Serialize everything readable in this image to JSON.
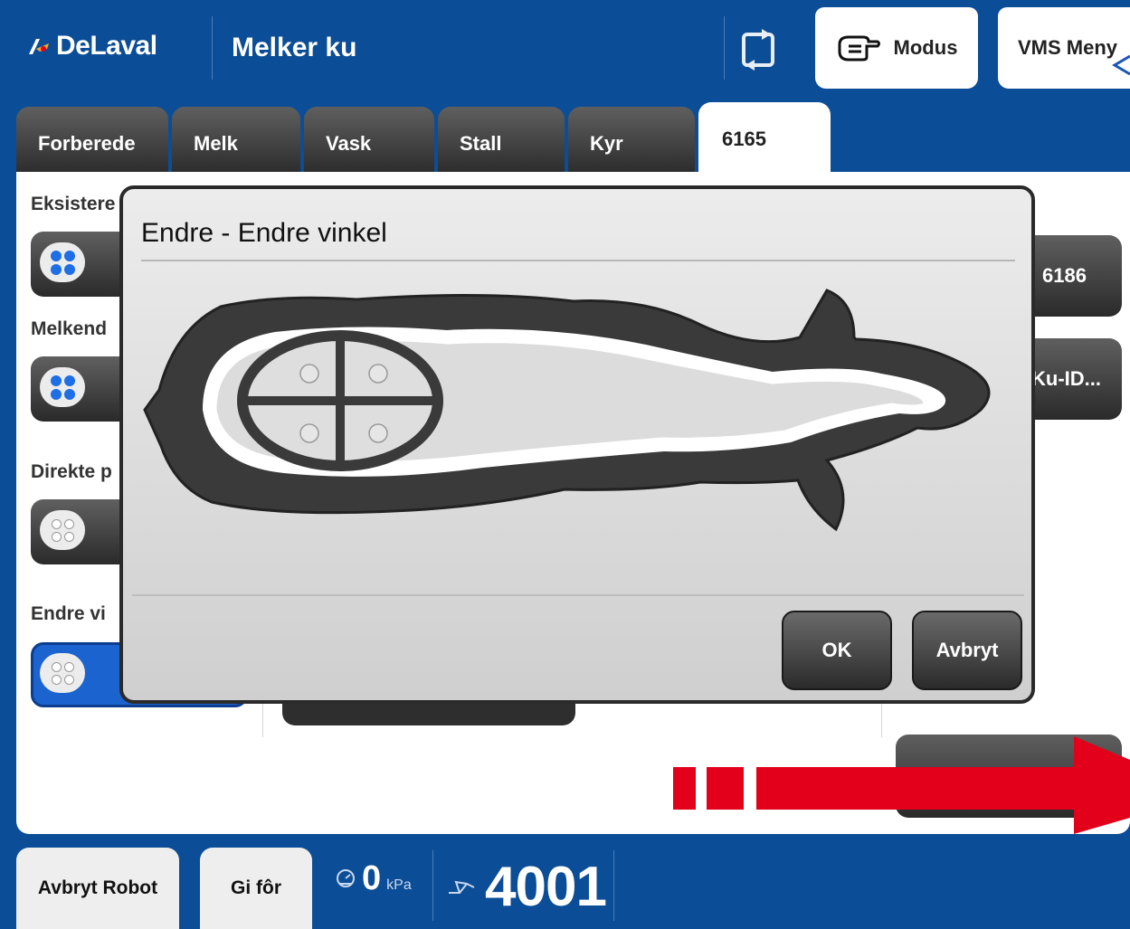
{
  "header": {
    "brand": "DeLaval",
    "title": "Melker ku",
    "modus_label": "Modus",
    "vms_menu_label": "VMS Meny"
  },
  "tabs": [
    {
      "label": "Forberede"
    },
    {
      "label": "Melk"
    },
    {
      "label": "Vask"
    },
    {
      "label": "Stall"
    },
    {
      "label": "Kyr"
    },
    {
      "label": "6165",
      "active": true
    }
  ],
  "main": {
    "sections": [
      {
        "label": "Eksistere",
        "teat_style": "blue"
      },
      {
        "label": "Melkend",
        "teat_style": "blue"
      },
      {
        "label": "Direkte p",
        "teat_style": "grey"
      },
      {
        "label": "Endre vi",
        "teat_style": "grey",
        "selected": true
      }
    ],
    "right_buttons": [
      {
        "label": "6186"
      },
      {
        "label": "Ku-ID..."
      },
      {
        "label": ""
      }
    ]
  },
  "dialog": {
    "title": "Endre - Endre vinkel",
    "ok_label": "OK",
    "cancel_label": "Avbryt"
  },
  "footer": {
    "abort_robot_label": "Avbryt Robot",
    "feed_label": "Gi fôr",
    "vacuum_value": "0",
    "vacuum_unit": "kPa",
    "robot_id": "4001"
  },
  "colors": {
    "header_blue": "#0b4d96",
    "selected_blue": "#1b64d0",
    "teat_blue": "#1e6ee6",
    "arrow_red": "#e2001a",
    "button_dark": "#2b2b2b"
  },
  "icons": {
    "sync": "sync-icon",
    "hand": "hand-pointing-icon",
    "vacuum": "gauge-icon",
    "robot": "robot-arm-icon"
  }
}
